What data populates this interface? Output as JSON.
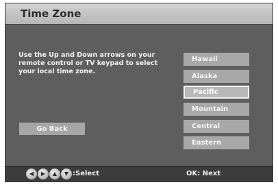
{
  "header": {
    "title": "Time Zone"
  },
  "instructions": "Use the Up and Down arrows on your remote control or TV keypad to select your local time zone.",
  "back_button": {
    "label": "Go Back"
  },
  "time_zones": [
    "Hawaii",
    "Alaska",
    "Pacific",
    "Mountain",
    "Central",
    "Eastern"
  ],
  "selected_zone": "Pacific",
  "footer": {
    "arrow_icons": [
      "left-arrow-icon",
      "right-arrow-icon",
      "up-arrow-icon",
      "down-arrow-icon"
    ],
    "select_label": ":Select",
    "ok_label": "OK: Next"
  }
}
